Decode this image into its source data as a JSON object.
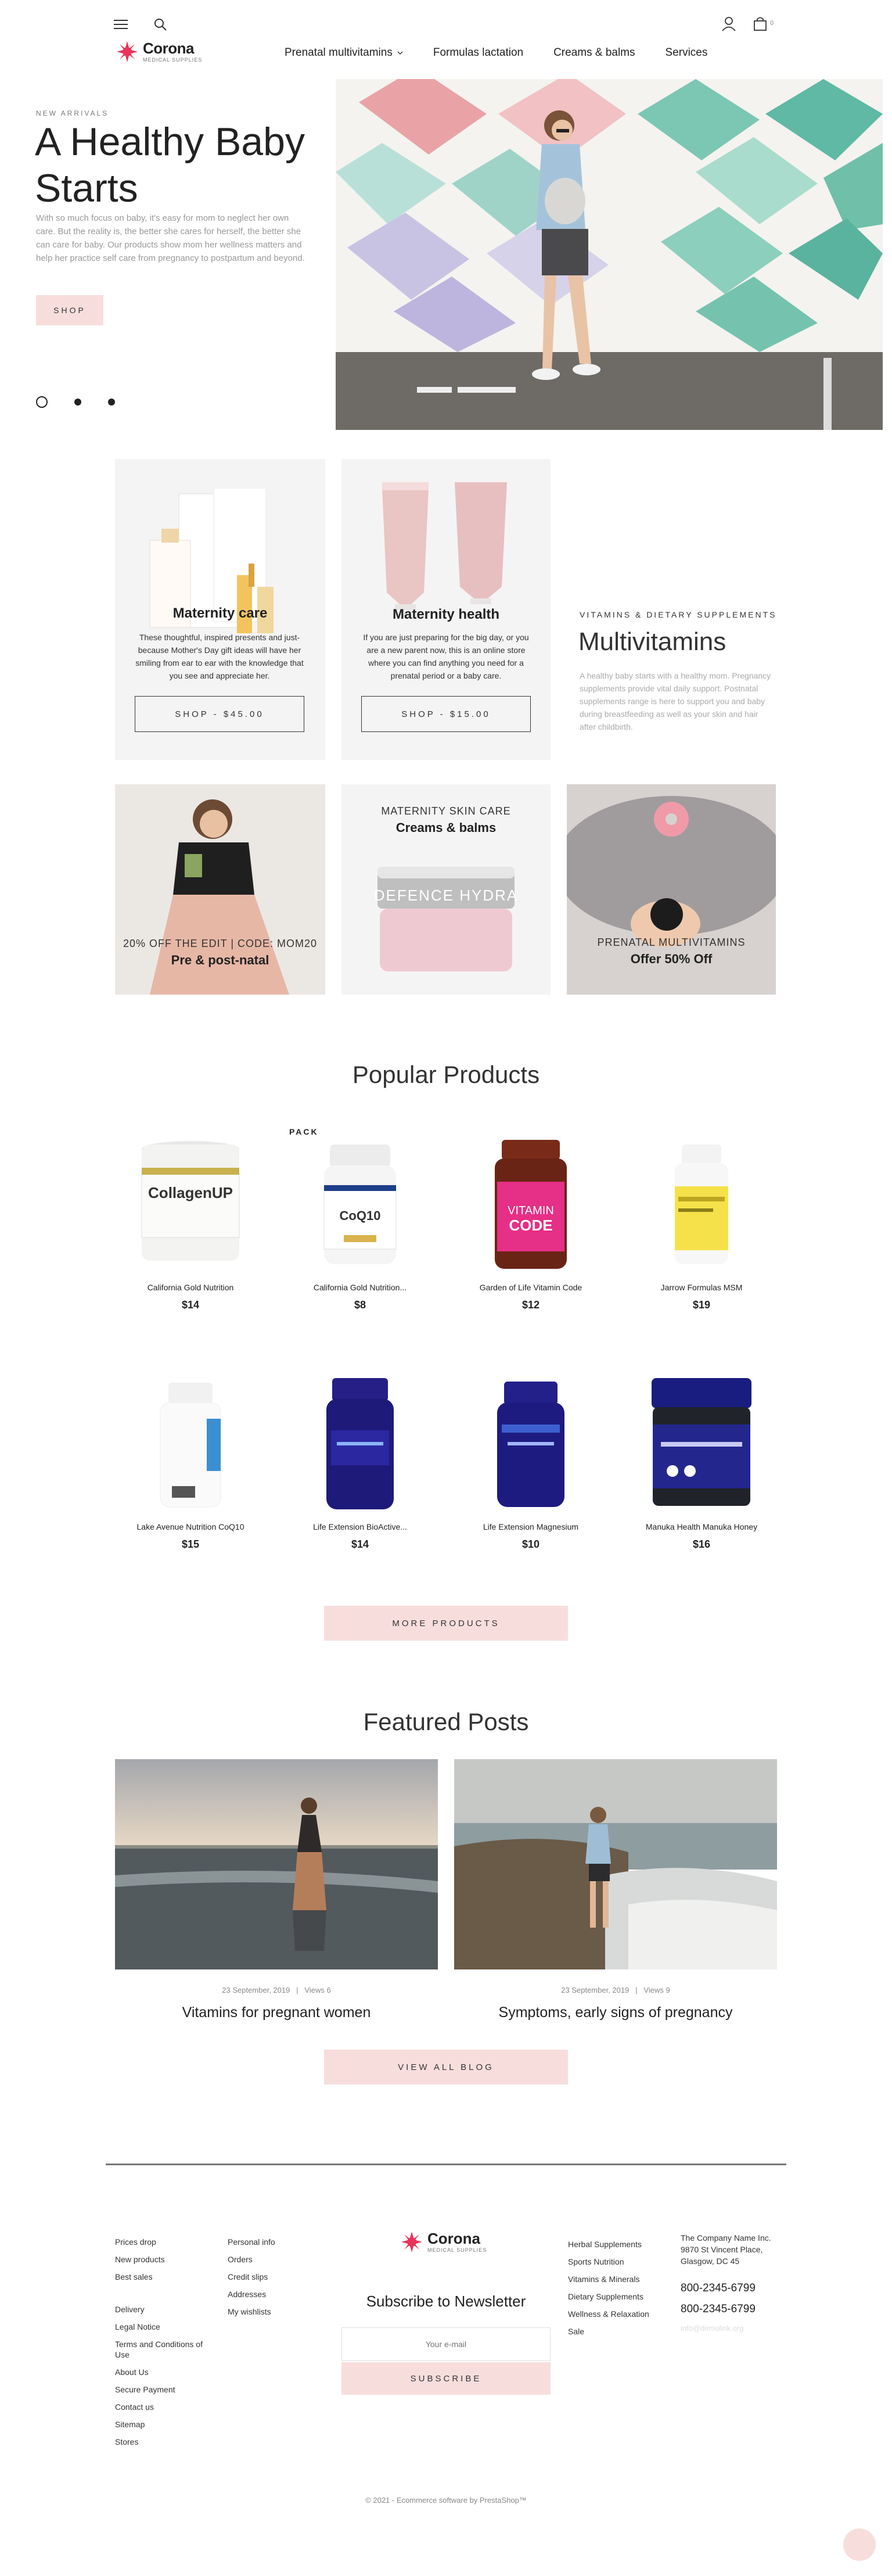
{
  "header": {
    "cart_count": "0",
    "logo_name": "Corona",
    "logo_sub": "MEDICAL SUPPLIES",
    "nav": [
      "Prenatal multivitamins",
      "Formulas lactation",
      "Creams & balms",
      "Services"
    ]
  },
  "hero": {
    "eyebrow": "NEW ARRIVALS",
    "title": "A Healthy Baby Starts",
    "desc": "With so much focus on baby, it's easy for mom to neglect her own care. But the reality is, the better she cares for herself, the better she can care for baby. Our products show mom her wellness matters and help her practice self care from pregnancy to postpartum and beyond.",
    "button": "SHOP"
  },
  "tiles": {
    "maternity_care": {
      "title": "Maternity care",
      "text": "These thoughtful, inspired presents and just-because Mother's Day gift ideas will have her smiling from ear to ear with the knowledge that you see and appreciate her.",
      "button": "SHOP - $45.00"
    },
    "maternity_health": {
      "title": "Maternity health",
      "text": "If you are just preparing for the big day, or you are a new parent now, this is an online store where you can find anything you need for a prenatal period or a baby care.",
      "button": "SHOP - $15.00"
    },
    "multivitamins": {
      "eyebrow": "VITAMINS & DIETARY SUPPLEMENTS",
      "title": "Multivitamins",
      "desc": "A healthy baby starts with a healthy mom. Pregnancy supplements provide vital daily support. Postnatal supplements range is here to support you and baby during breastfeeding as well as your skin and hair after childbirth."
    },
    "promo1": {
      "top": "20% OFF THE EDIT | CODE: MOM20",
      "bottom": "Pre & post-natal"
    },
    "promo2": {
      "top": "MATERNITY SKIN CARE",
      "bottom": "Creams & balms"
    },
    "promo3": {
      "top": "PRENATAL MULTIVITAMINS",
      "bottom": "Offer 50% Off"
    }
  },
  "popular": {
    "title": "Popular Products",
    "pack_label": "PACK",
    "products": [
      {
        "name": "California Gold Nutrition",
        "price": "$14"
      },
      {
        "name": "California Gold Nutrition...",
        "price": "$8"
      },
      {
        "name": "Garden of Life Vitamin Code",
        "price": "$12"
      },
      {
        "name": "Jarrow Formulas MSM",
        "price": "$19"
      },
      {
        "name": "Lake Avenue Nutrition CoQ10",
        "price": "$15"
      },
      {
        "name": "Life Extension BioActive...",
        "price": "$14"
      },
      {
        "name": "Life Extension Magnesium",
        "price": "$10"
      },
      {
        "name": "Manuka Health Manuka Honey",
        "price": "$16"
      }
    ],
    "more_button": "MORE PRODUCTS"
  },
  "posts": {
    "title": "Featured Posts",
    "items": [
      {
        "date": "23 September, 2019",
        "views": "Views 6",
        "title": "Vitamins for pregnant women"
      },
      {
        "date": "23 September, 2019",
        "views": "Views 9",
        "title": "Symptoms, early signs of pregnancy"
      }
    ],
    "view_all": "VIEW ALL BLOG"
  },
  "footer": {
    "col1": [
      "Prices drop",
      "New products",
      "Best sales"
    ],
    "col1b": [
      "Delivery",
      "Legal Notice",
      "Terms and Conditions of Use",
      "About Us",
      "Secure Payment",
      "Contact us",
      "Sitemap",
      "Stores"
    ],
    "col2": [
      "Personal info",
      "Orders",
      "Credit slips",
      "Addresses",
      "My wishlists"
    ],
    "logo_name": "Corona",
    "logo_sub": "MEDICAL SUPPLIES",
    "newsletter_title": "Subscribe to Newsletter",
    "newsletter_placeholder": "Your e-mail",
    "subscribe": "SUBSCRIBE",
    "col4": [
      "Herbal Supplements",
      "Sports Nutrition",
      "Vitamins & Minerals",
      "Dietary Supplements",
      "Wellness & Relaxation",
      "Sale"
    ],
    "address": "The Company Name Inc. 9870 St Vincent Place, Glasgow, DC 45",
    "phone1": "800-2345-6799",
    "phone2": "800-2345-6799",
    "email": "info@demolink.org",
    "copyright": "© 2021 - Ecommerce software by PrestaShop™"
  }
}
